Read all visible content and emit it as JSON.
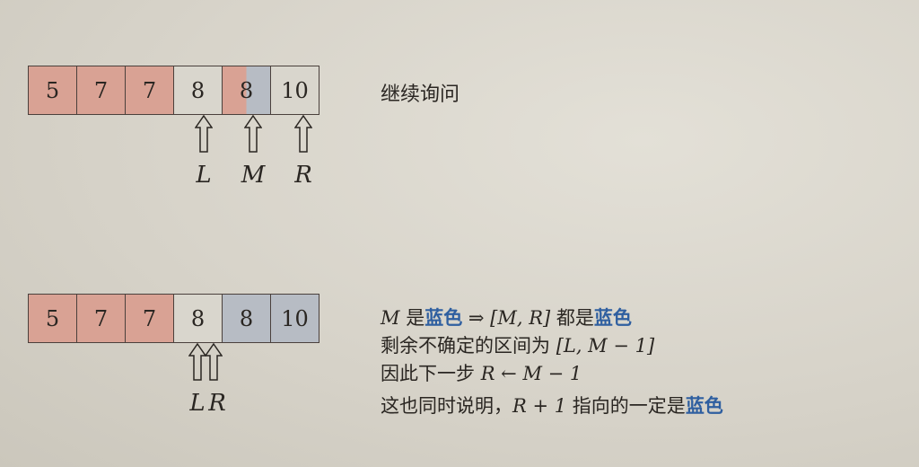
{
  "top": {
    "cells": [
      {
        "value": "5",
        "color": "red"
      },
      {
        "value": "7",
        "color": "red"
      },
      {
        "value": "7",
        "color": "red"
      },
      {
        "value": "8",
        "color": "none"
      },
      {
        "value": "8",
        "color": "red-blue"
      },
      {
        "value": "10",
        "color": "none"
      }
    ],
    "pointers": [
      "L",
      "M",
      "R"
    ],
    "caption": "继续询问"
  },
  "bottom": {
    "cells": [
      {
        "value": "5",
        "color": "red"
      },
      {
        "value": "7",
        "color": "red"
      },
      {
        "value": "7",
        "color": "red"
      },
      {
        "value": "8",
        "color": "none"
      },
      {
        "value": "8",
        "color": "blue"
      },
      {
        "value": "10",
        "color": "blue"
      }
    ],
    "pointers": [
      "L",
      "R"
    ],
    "lines": {
      "l1": {
        "a": "M",
        "b": " 是",
        "c": "蓝色",
        "d": " ⇒ [M, R]",
        "e": " 都是",
        "f": "蓝色"
      },
      "l2": {
        "a": "剩余不确定的区间为 ",
        "b": "[L, M − 1]"
      },
      "l3": {
        "a": "因此下一步 ",
        "b": "R ← M − 1"
      },
      "l4": {
        "a": "这也同时说明，",
        "b": "R + 1",
        "c": " 指向的一定是",
        "d": "蓝色"
      }
    }
  },
  "colors": {
    "red": "#d9a294",
    "blue": "#b7bcc4",
    "highlight_text": "#2f5fa0"
  }
}
